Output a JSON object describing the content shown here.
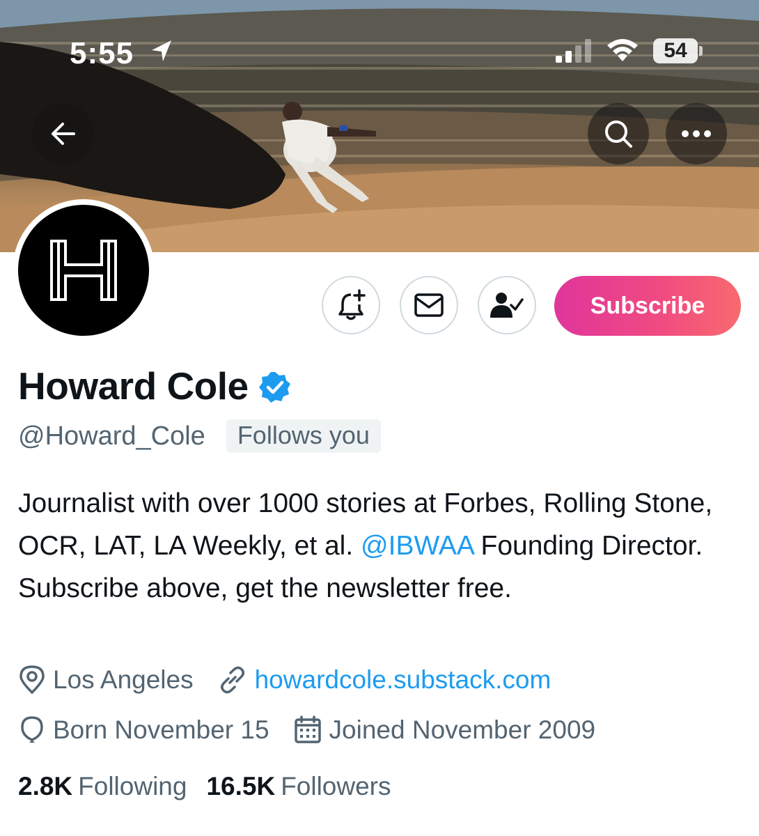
{
  "status_bar": {
    "time": "5:55",
    "battery": "54"
  },
  "profile": {
    "display_name": "Howard Cole",
    "handle": "@Howard_Cole",
    "follows_you": "Follows you",
    "bio_part1": "Journalist with over 1000 stories at Forbes, Rolling Stone, OCR, LAT, LA Weekly, et al. ",
    "bio_mention": "@IBWAA",
    "bio_part2": " Founding Director. Subscribe above, get the newsletter free.",
    "location": "Los Angeles",
    "website": "howardcole.substack.com",
    "birthday": "Born November 15",
    "joined": "Joined November 2009",
    "following_count": "2.8K",
    "following_label": "Following",
    "followers_count": "16.5K",
    "followers_label": "Followers"
  },
  "actions": {
    "subscribe_label": "Subscribe"
  },
  "icons": {
    "back": "arrow-left-icon",
    "search": "search-icon",
    "more": "more-icon",
    "notify": "bell-plus-icon",
    "message": "envelope-icon",
    "following": "person-check-icon",
    "verified": "verified-badge-icon",
    "location": "location-pin-icon",
    "link": "link-icon",
    "birthday": "balloon-icon",
    "calendar": "calendar-icon"
  },
  "colors": {
    "accent": "#1d9bf0",
    "subscribe_gradient_start": "#e0359b",
    "subscribe_gradient_end": "#f86a6e",
    "text_secondary": "#536471"
  }
}
